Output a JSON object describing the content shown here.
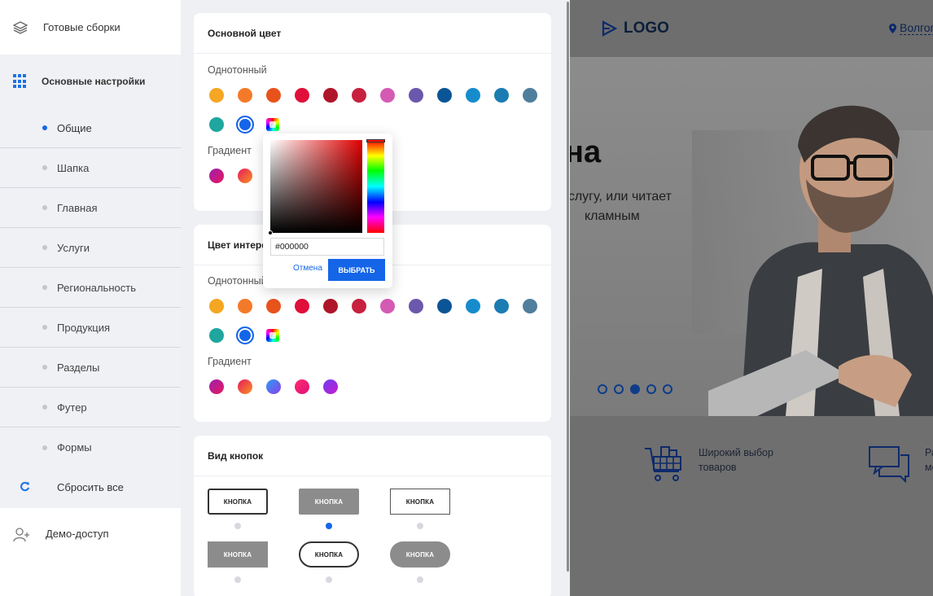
{
  "sidebar": {
    "ready_builds": "Готовые сборки",
    "main_settings": "Основные настройки",
    "items": [
      {
        "label": "Общие",
        "active": true
      },
      {
        "label": "Шапка",
        "active": false
      },
      {
        "label": "Главная",
        "active": false
      },
      {
        "label": "Услуги",
        "active": false
      },
      {
        "label": "Региональность",
        "active": false
      },
      {
        "label": "Продукция",
        "active": false
      },
      {
        "label": "Разделы",
        "active": false
      },
      {
        "label": "Футер",
        "active": false
      },
      {
        "label": "Формы",
        "active": false
      }
    ],
    "reset": "Сбросить все",
    "demo": "Демо-доступ"
  },
  "main_color": {
    "title": "Основной цвет",
    "solid_label": "Однотонный",
    "gradient_label": "Градиент"
  },
  "interface_color": {
    "title": "Цвет интерфейса",
    "solid_label": "Однотонный",
    "gradient_label": "Градиент"
  },
  "colors": {
    "solid": [
      "#f5a623",
      "#f47a2a",
      "#e8531c",
      "#e0103a",
      "#b0162a",
      "#c8213f",
      "#d45bb4",
      "#6b58ad",
      "#0b5596",
      "#178ccc",
      "#1b7cb2",
      "#4f7f9c",
      "#1ea69f",
      "#1565e8"
    ],
    "gradient": [
      "#c81a8e",
      "#f26a1d",
      "#5f72ff",
      "#f0197d",
      "#8a3ff0"
    ],
    "accent": "#1565e8"
  },
  "picker": {
    "hex_value": "#000000",
    "cancel": "Отмена",
    "choose": "ВЫБРАТЬ"
  },
  "buttons_view": {
    "title": "Вид кнопок",
    "button_label": "КНОПКА",
    "selected_index": 1
  },
  "preview": {
    "logo": "LOGO",
    "city": "Волгог",
    "hero_title": "на",
    "hero_text_line1": "услугу, или читает",
    "hero_text_line2": "кламным",
    "feature1_line1": "Широкий выбор",
    "feature1_line2": "товаров",
    "feature2_line1": "Ра",
    "feature2_line2": "ме",
    "slider_active": 2
  }
}
